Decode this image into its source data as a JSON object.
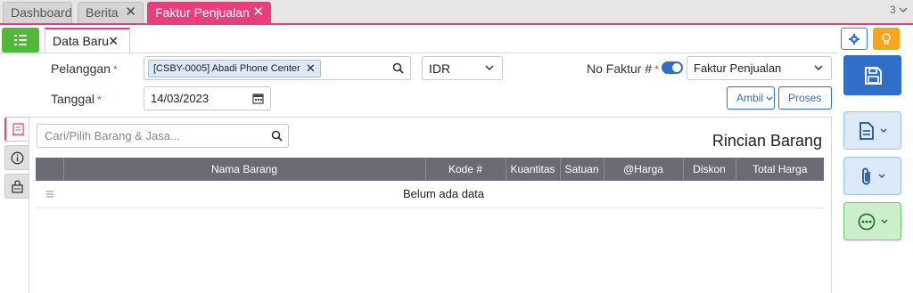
{
  "top_tabs": [
    {
      "label": "Dashboard"
    },
    {
      "label": "Berita"
    },
    {
      "label": "Faktur Penjualan"
    }
  ],
  "top_tab_count": "3",
  "sub_tab": {
    "label": "Data Baru"
  },
  "form": {
    "pelanggan_label": "Pelanggan",
    "pelanggan_value": "[CSBY-0005] Abadi Phone Center",
    "currency_value": "IDR",
    "tanggal_label": "Tanggal",
    "tanggal_value": "14/03/2023",
    "no_faktur_label": "No Faktur #",
    "no_faktur_type": "Faktur Penjualan",
    "required_mark": "*"
  },
  "buttons": {
    "ambil": "Ambil",
    "proses": "Proses"
  },
  "detail": {
    "search_placeholder": "Cari/Pilih Barang & Jasa...",
    "title": "Rincian Barang",
    "columns": [
      "Nama Barang",
      "Kode #",
      "Kuantitas",
      "Satuan",
      "@Harga",
      "Diskon",
      "Total Harga"
    ],
    "empty_text": "Belum ada data"
  },
  "icons": {
    "menu": "list-icon",
    "settings": "gear-icon",
    "tips": "lightbulb-icon",
    "save": "floppy-disk-icon",
    "document": "document-icon",
    "attachment": "paperclip-icon",
    "more": "ellipsis-circle-icon",
    "search": "search-icon",
    "calendar": "calendar-icon",
    "detail_tab": "receipt-icon",
    "info_tab": "info-icon",
    "extra_tab": "bag-icon",
    "row_handle": "drag-handle-icon"
  },
  "colors": {
    "accent_pink": "#e83e7c",
    "primary_blue": "#2f6fc9",
    "menu_green": "#52b83a",
    "bulb_orange": "#f7a51c",
    "header_gray": "#6b6b75"
  }
}
